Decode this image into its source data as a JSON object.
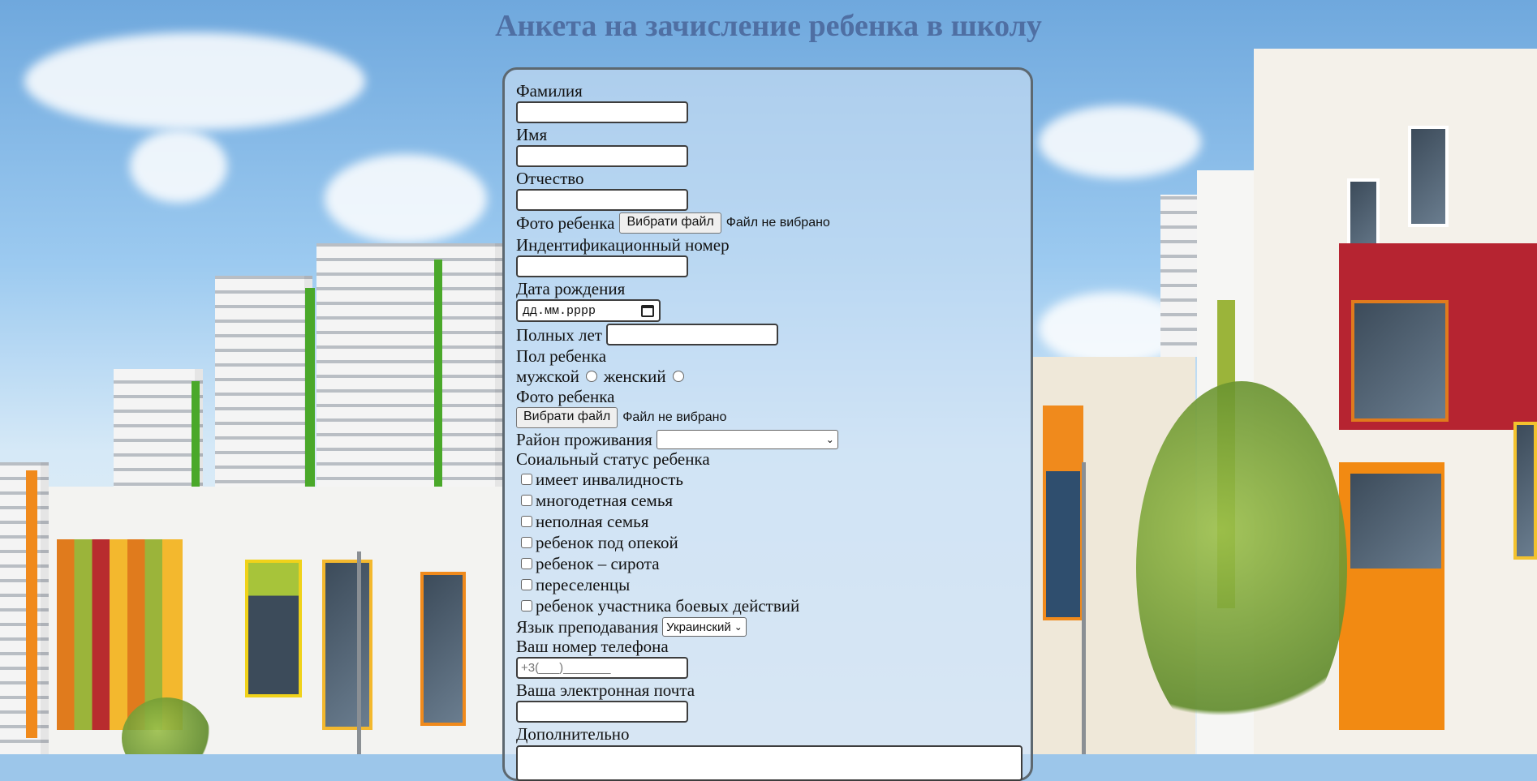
{
  "page": {
    "title": "Анкета на зачисление ребенка в школу"
  },
  "form": {
    "surname_label": "Фамилия",
    "name_label": "Имя",
    "patronymic_label": "Отчество",
    "photo1_label": "Фото ребенка",
    "photo1_button": "Вибрати файл",
    "photo1_status": "Файл не вибрано",
    "id_label": "Индентификационный номер",
    "birth_label": "Дата рождения",
    "birth_placeholder": "дд.мм.рррр",
    "age_label": "Полных лет",
    "gender_label": "Пол ребенка",
    "gender_male": "мужской",
    "gender_female": "женский",
    "photo2_label": "Фото ребенка",
    "photo2_button": "Вибрати файл",
    "photo2_status": "Файл не вибрано",
    "district_label": "Район проживания",
    "district_value": "",
    "social_label": "Соиальный статус ребенка",
    "social_options": [
      "имеет инвалидность",
      "многодетная семья",
      "неполная семья",
      "ребенок под опекой",
      "ребенок – сирота",
      "переселенцы",
      "ребенок участника боевых действий"
    ],
    "language_label": "Язык преподавания",
    "language_value": "Украинский",
    "phone_label": "Ваш номер телефона",
    "phone_placeholder": "+3(___)_______",
    "email_label": "Ваша электронная почта",
    "extra_label": "Дополнительно"
  },
  "colors": {
    "title": "#4f6fa3",
    "panel_border": "#5d6870"
  },
  "icons": {
    "calendar": "calendar-icon",
    "select_arrow": "chevron-down-icon"
  }
}
